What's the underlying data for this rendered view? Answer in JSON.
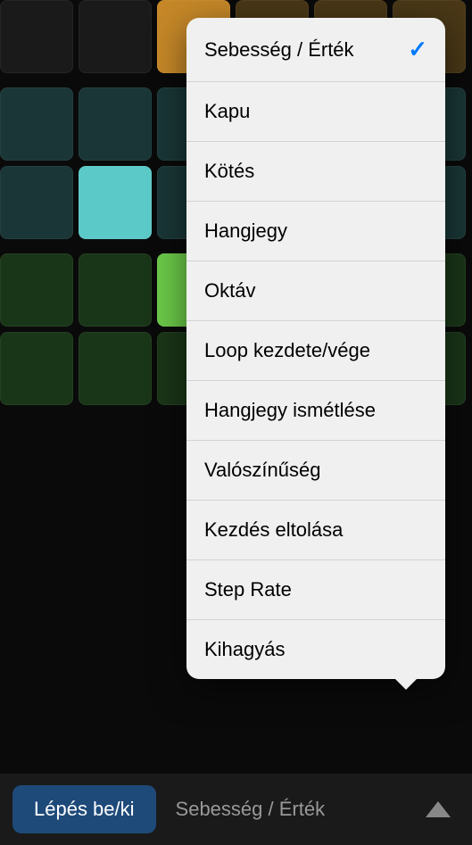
{
  "popup": {
    "items": [
      {
        "label": "Sebesség / Érték",
        "selected": true
      },
      {
        "label": "Kapu",
        "selected": false
      },
      {
        "label": "Kötés",
        "selected": false
      },
      {
        "label": "Hangjegy",
        "selected": false
      },
      {
        "label": "Oktáv",
        "selected": false
      },
      {
        "label": "Loop kezdete/vége",
        "selected": false
      },
      {
        "label": "Hangjegy ismétlése",
        "selected": false
      },
      {
        "label": "Valószínűség",
        "selected": false
      },
      {
        "label": "Kezdés eltolása",
        "selected": false
      },
      {
        "label": "Step Rate",
        "selected": false
      },
      {
        "label": "Kihagyás",
        "selected": false
      }
    ]
  },
  "bottomBar": {
    "stepToggleLabel": "Lépés be/ki",
    "modeLabel": "Sebesség / Érték"
  },
  "grid": {
    "rows": [
      [
        "cell-dim",
        "cell-dim",
        "cell-orange",
        "cell-orange-dim",
        "cell-orange-dim",
        "cell-orange-dim"
      ],
      [
        "cell-teal-dark",
        "cell-teal-dark",
        "cell-teal-dark",
        "cell-teal-bright",
        "cell-teal-dark",
        "cell-teal-dark"
      ],
      [
        "cell-teal-dark",
        "cell-teal-bright",
        "cell-teal-dark",
        "cell-teal-dark",
        "cell-teal-dark",
        "cell-teal-dark"
      ],
      [
        "cell-green-dark",
        "cell-green-dark",
        "cell-green-bright",
        "cell-green-dark",
        "cell-green-dark",
        "cell-green-dark"
      ],
      [
        "cell-green-dark",
        "cell-green-dark",
        "cell-green-dark",
        "cell-green-dark",
        "cell-green-dark",
        "cell-green-dark"
      ]
    ]
  }
}
